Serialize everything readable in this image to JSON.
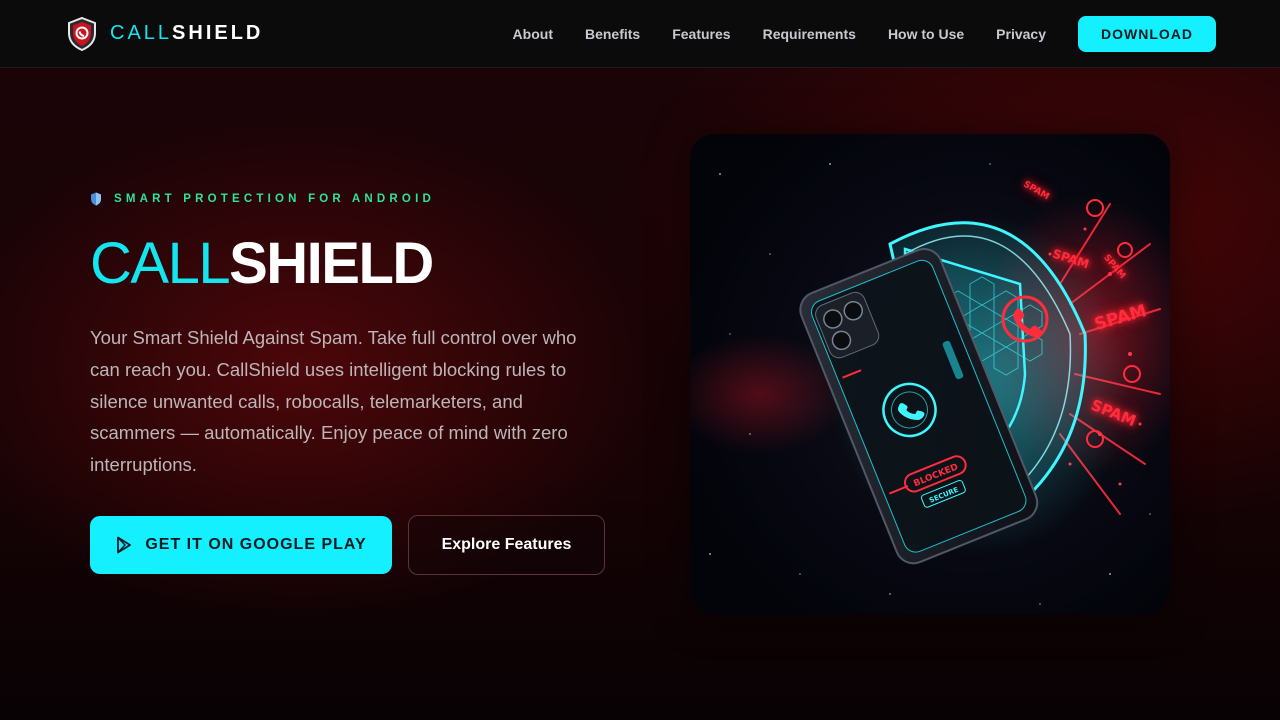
{
  "brand": {
    "name_part1": "CALL",
    "name_part2": "SHIELD"
  },
  "nav": {
    "links": [
      "About",
      "Benefits",
      "Features",
      "Requirements",
      "How to Use",
      "Privacy"
    ],
    "download_label": "DOWNLOAD"
  },
  "hero": {
    "eyebrow": "SMART PROTECTION FOR ANDROID",
    "title_part1": "CALL",
    "title_part2": "SHIELD",
    "description": "Your Smart Shield Against Spam. Take full control over who can reach you. CallShield uses intelligent blocking rules to silence unwanted calls, robocalls, telemarketers, and scammers — automatically. Enjoy peace of mind with zero interruptions.",
    "primary_button": "GET IT ON GOOGLE PLAY",
    "secondary_button": "Explore Features"
  },
  "illustration": {
    "spam_labels": [
      "SPAM",
      "SPAM",
      "SPAM",
      "SPAM",
      "SPAM"
    ],
    "phone_blocked_label": "BLOCKED",
    "phone_secure_label": "SECURE"
  },
  "colors": {
    "accent": "#14f0ff",
    "eyebrow_green": "#2ee39a",
    "spam_red": "#ff2d3c"
  }
}
